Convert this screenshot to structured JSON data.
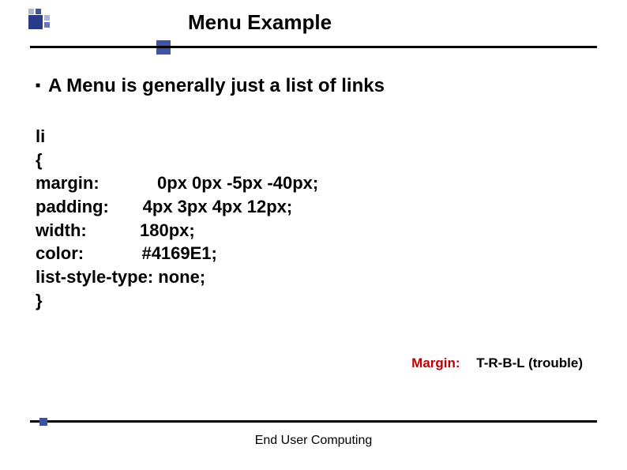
{
  "title": "Menu Example",
  "bullet_text": "A Menu is generally just a list of links",
  "code": {
    "l1": "li",
    "l2": "{",
    "l3": "margin:            0px 0px -5px -40px;",
    "l4": "padding:       4px 3px 4px 12px;",
    "l5": "width:           180px;",
    "l6": "color:            #4169E1;",
    "l7": "list-style-type: none;",
    "l8": "}"
  },
  "note_label": "Margin:",
  "note_text": "T-R-B-L (trouble)",
  "footer": "End User Computing"
}
